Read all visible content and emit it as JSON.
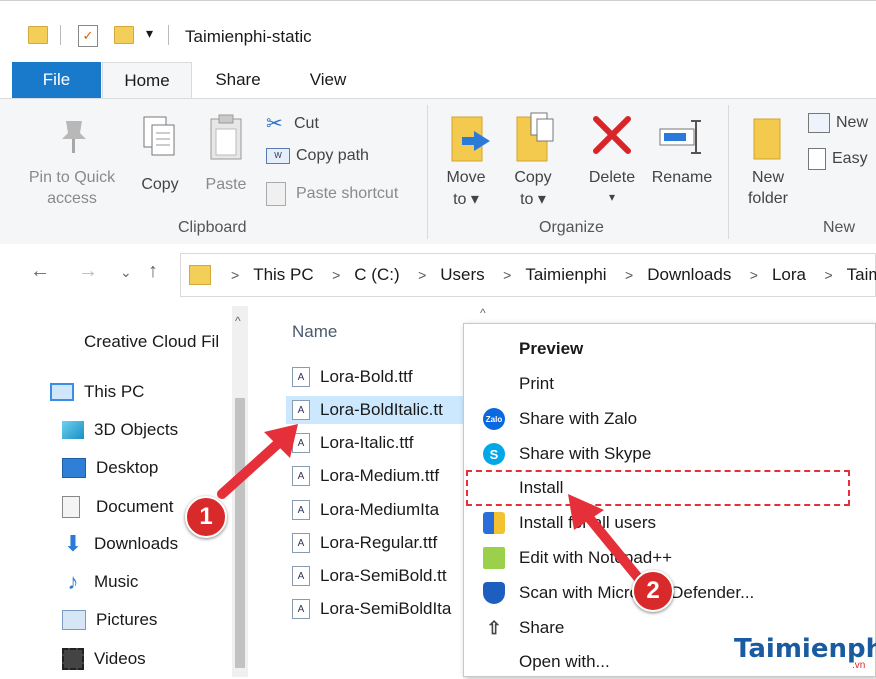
{
  "window": {
    "title": "Taimienphi-static"
  },
  "tabs": [
    {
      "label": "File"
    },
    {
      "label": "Home"
    },
    {
      "label": "Share"
    },
    {
      "label": "View"
    }
  ],
  "ribbon": {
    "clipboard": {
      "pin_line1": "Pin to Quick",
      "pin_line2": "access",
      "copy": "Copy",
      "paste": "Paste",
      "cut": "Cut",
      "copy_path": "Copy path",
      "paste_shortcut": "Paste shortcut",
      "group_label": "Clipboard"
    },
    "organize": {
      "move_line1": "Move",
      "move_line2": "to",
      "copy_line1": "Copy",
      "copy_line2": "to",
      "delete": "Delete",
      "rename": "Rename",
      "group_label": "Organize"
    },
    "new": {
      "new_folder_line1": "New",
      "new_folder_line2": "folder",
      "new_item": "New",
      "easy_access": "Easy",
      "group_label": "New"
    }
  },
  "address": {
    "crumbs": [
      "This PC",
      "C (C:)",
      "Users",
      "Taimienphi",
      "Downloads",
      "Lora",
      "Taimi"
    ]
  },
  "navpane": {
    "items": [
      {
        "label": "Creative Cloud Fil",
        "icon": "creative-cloud-icon"
      },
      {
        "label": "This PC",
        "icon": "computer-icon"
      },
      {
        "label": "3D Objects",
        "icon": "cube-icon"
      },
      {
        "label": "Desktop",
        "icon": "desktop-icon"
      },
      {
        "label": "Document",
        "icon": "document-icon"
      },
      {
        "label": "Downloads",
        "icon": "download-arrow-icon"
      },
      {
        "label": "Music",
        "icon": "music-note-icon"
      },
      {
        "label": "Pictures",
        "icon": "picture-icon"
      },
      {
        "label": "Videos",
        "icon": "film-icon"
      }
    ]
  },
  "filelist": {
    "header": "Name",
    "files": [
      {
        "name": "Lora-Bold.ttf"
      },
      {
        "name": "Lora-BoldItalic.tt"
      },
      {
        "name": "Lora-Italic.ttf"
      },
      {
        "name": "Lora-Medium.ttf"
      },
      {
        "name": "Lora-MediumIta"
      },
      {
        "name": "Lora-Regular.ttf"
      },
      {
        "name": "Lora-SemiBold.tt"
      },
      {
        "name": "Lora-SemiBoldIta"
      }
    ]
  },
  "contextmenu": {
    "items": [
      {
        "label": "Preview",
        "icon": ""
      },
      {
        "label": "Print",
        "icon": ""
      },
      {
        "label": "Share with Zalo",
        "icon": "zalo-icon"
      },
      {
        "label": "Share with Skype",
        "icon": "skype-icon"
      },
      {
        "label": "Install",
        "icon": ""
      },
      {
        "label": "Install for all users",
        "icon": "uac-shield-icon"
      },
      {
        "label": "Edit with Notepad++",
        "icon": "notepad-plus-icon"
      },
      {
        "label": "Scan with Microsoft Defender...",
        "icon": "defender-shield-icon"
      },
      {
        "label": "Share",
        "icon": "share-icon"
      },
      {
        "label": "Open with...",
        "icon": ""
      }
    ]
  },
  "annotations": {
    "step1": "1",
    "step2": "2",
    "accent": "#e5303a"
  },
  "watermark": {
    "text": "Taimienphi",
    "suffix": ".vn"
  }
}
